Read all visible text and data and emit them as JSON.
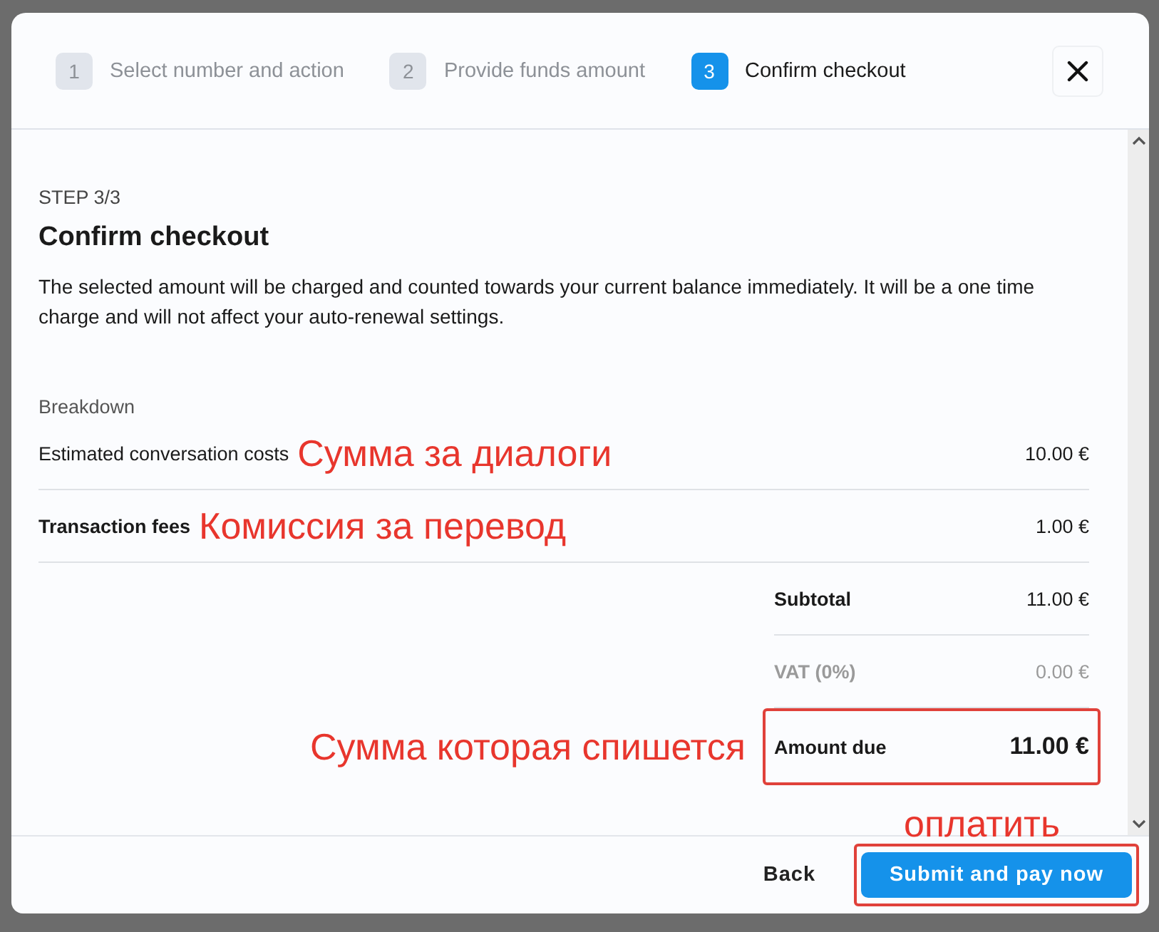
{
  "steps": [
    {
      "number": "1",
      "label": "Select number and action",
      "selected": false
    },
    {
      "number": "2",
      "label": "Provide funds amount",
      "selected": false
    },
    {
      "number": "3",
      "label": "Confirm checkout",
      "selected": true
    }
  ],
  "body": {
    "step_label": "STEP 3/3",
    "title": "Confirm checkout",
    "description": "The selected amount will be charged and counted towards your current balance immediately. It will be a one time charge and will not affect your auto-renewal settings.",
    "breakdown_label": "Breakdown",
    "lines": [
      {
        "label": "Estimated conversation costs",
        "amount": "10.00 €",
        "bold": false,
        "note": "Сумма за диалоги"
      },
      {
        "label": "Transaction fees",
        "amount": "1.00 €",
        "bold": true,
        "note": "Комиссия за перевод"
      }
    ],
    "summary": [
      {
        "label": "Subtotal",
        "amount": "11.00 €",
        "kind": "normal",
        "highlighted": false
      },
      {
        "label": "VAT (0%)",
        "amount": "0.00 €",
        "kind": "muted",
        "highlighted": false
      },
      {
        "label": "Amount due",
        "amount": "11.00 €",
        "kind": "total",
        "highlighted": true,
        "note": "Сумма которая спишется"
      }
    ]
  },
  "footer": {
    "back": "Back",
    "submit": "Submit and pay now",
    "submit_highlighted": true,
    "submit_note": "оплатить"
  }
}
